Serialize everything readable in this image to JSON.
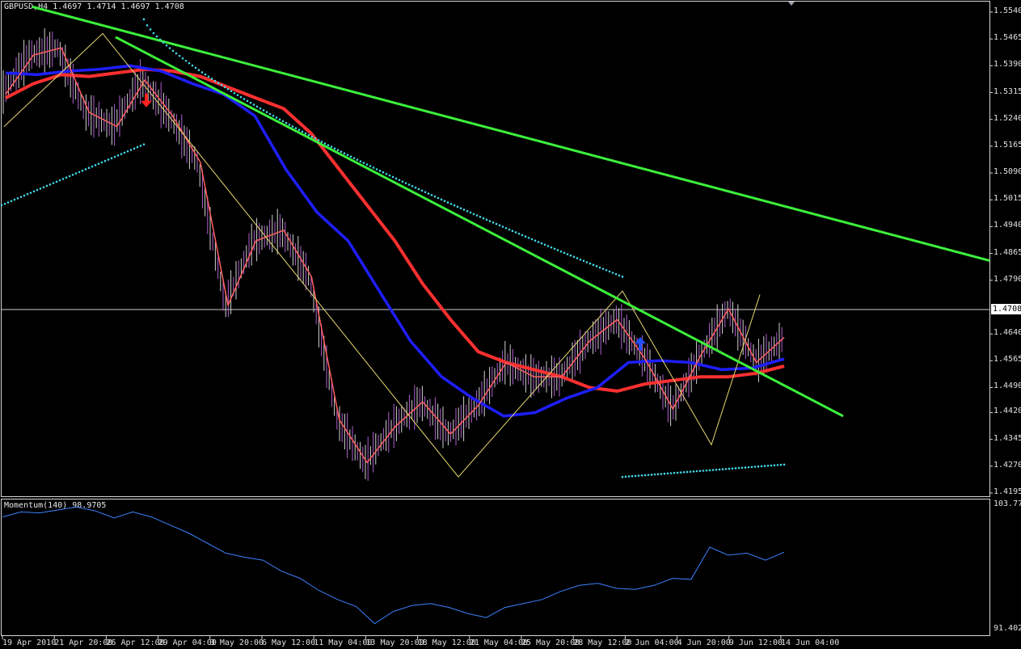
{
  "chart_data": [
    {
      "type": "line",
      "symbol_header": "GBPUSD,H4  1.4697 1.4714 1.4697 1.4708",
      "current_price": "1.4708",
      "y_ticks": [
        "1.5540",
        "1.5465",
        "1.5390",
        "1.5315",
        "1.5240",
        "1.5165",
        "1.5090",
        "1.5015",
        "1.4940",
        "1.4865",
        "1.4790",
        "1.4640",
        "1.4565",
        "1.4490",
        "1.4420",
        "1.4345",
        "1.4270",
        "1.4195"
      ],
      "x_ticks": [
        "19 Apr 2010",
        "21 Apr 20:00",
        "26 Apr 12:00",
        "29 Apr 04:00",
        "3 May 20:00",
        "6 May 12:00",
        "11 May 04:00",
        "13 May 20:00",
        "18 May 12:00",
        "21 May 04:00",
        "25 May 20:00",
        "28 May 12:00",
        "2 Jun 04:00",
        "4 Jun 20:00",
        "9 Jun 12:00",
        "14 Jun 04:00"
      ],
      "ylim": [
        1.4195,
        1.554
      ],
      "series": [
        {
          "color": "#ff3030",
          "values": [
            1.53,
            1.534,
            1.5365,
            1.536,
            1.537,
            1.538,
            1.5375,
            1.536,
            1.533,
            1.53,
            1.527,
            1.52,
            1.51,
            1.5,
            1.49,
            1.478,
            1.468,
            1.459,
            1.456,
            1.454,
            1.452,
            1.449,
            1.448,
            1.45,
            1.451,
            1.452,
            1.452,
            1.453,
            1.455
          ]
        },
        {
          "color": "#1e1eff",
          "values": [
            1.537,
            1.5365,
            1.5375,
            1.538,
            1.539,
            1.5375,
            1.534,
            1.531,
            1.525,
            1.51,
            1.498,
            1.49,
            1.476,
            1.462,
            1.452,
            1.446,
            1.441,
            1.442,
            1.446,
            1.449,
            1.456,
            1.4565,
            1.456,
            1.454,
            1.4545,
            1.457
          ]
        },
        {
          "color": "#ff6060",
          "values": [
            1.531,
            1.542,
            1.544,
            1.526,
            1.522,
            1.535,
            1.525,
            1.512,
            1.472,
            1.49,
            1.493,
            1.48,
            1.44,
            1.428,
            1.438,
            1.445,
            1.436,
            1.444,
            1.456,
            1.452,
            1.452,
            1.462,
            1.468,
            1.457,
            1.443,
            1.458,
            1.471,
            1.456,
            1.463
          ]
        }
      ],
      "zigzag": [
        1.522,
        1.548,
        1.424,
        1.476,
        1.433,
        1.475
      ],
      "trendlines": [
        {
          "color": "#3cf03c",
          "from": 1.5555,
          "to": 1.4845
        },
        {
          "color": "#3cf03c",
          "from": 1.547,
          "to": 1.441
        }
      ],
      "parabolic_dots": [
        {
          "from": 1.5,
          "to": 1.517
        },
        {
          "from": 1.552,
          "to": 1.48
        },
        {
          "from": 1.424,
          "to": 1.4275
        }
      ],
      "arrows": [
        {
          "direction": "down",
          "color": "#ff2020",
          "value": 1.5285
        },
        {
          "direction": "up",
          "color": "#2050ff",
          "value": 1.462
        }
      ]
    },
    {
      "type": "line",
      "title": "Momentum(140) 98.9705",
      "y_ticks": [
        "103.775",
        "91.4024"
      ],
      "ylim": [
        91.4024,
        103.775
      ],
      "series": [
        {
          "color": "#3c82ff",
          "values": [
            102.6,
            103.1,
            103.0,
            103.3,
            103.6,
            103.2,
            102.5,
            103.1,
            102.6,
            101.8,
            101.0,
            100.0,
            99.0,
            98.6,
            98.3,
            97.2,
            96.5,
            95.3,
            94.4,
            93.7,
            92.0,
            93.2,
            93.8,
            94.0,
            93.6,
            93.0,
            92.6,
            93.6,
            94.0,
            94.4,
            95.2,
            95.8,
            96.0,
            95.5,
            95.4,
            95.8,
            96.5,
            96.4,
            99.6,
            98.8,
            99.0,
            98.3,
            99.1
          ]
        }
      ]
    }
  ]
}
